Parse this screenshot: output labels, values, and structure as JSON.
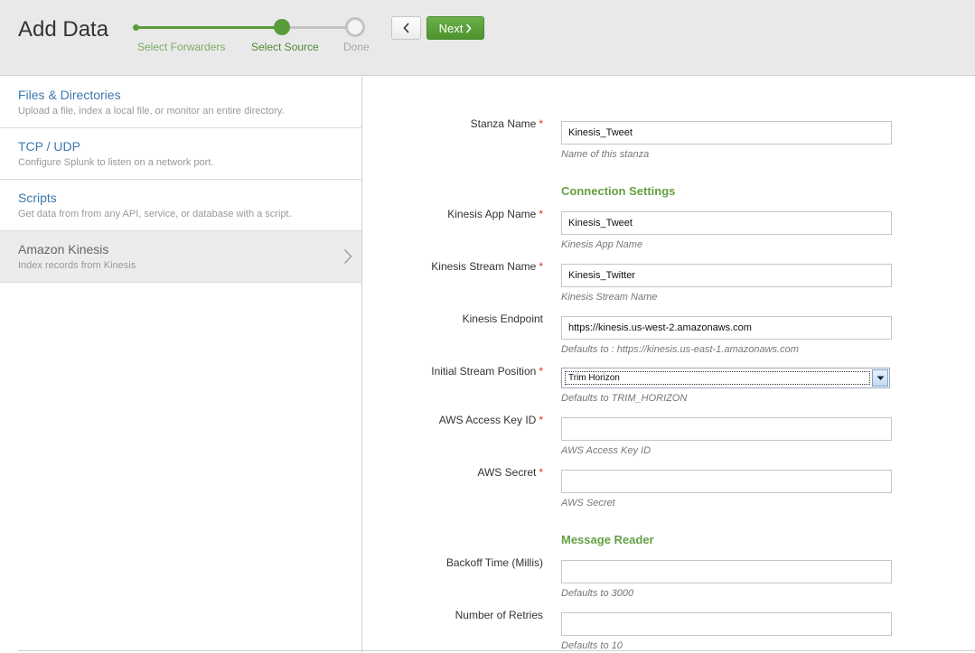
{
  "header": {
    "title": "Add Data",
    "steps": [
      "Select Forwarders",
      "Select Source",
      "Done"
    ],
    "next_label": "Next"
  },
  "sidebar": {
    "items": [
      {
        "title": "Files & Directories",
        "desc": "Upload a file, index a local file, or monitor an entire directory."
      },
      {
        "title": "TCP / UDP",
        "desc": "Configure Splunk to listen on a network port."
      },
      {
        "title": "Scripts",
        "desc": "Get data from from any API, service, or database with a script."
      },
      {
        "title": "Amazon Kinesis",
        "desc": "Index records from Kinesis"
      }
    ]
  },
  "form": {
    "stanza_name": {
      "label": "Stanza Name",
      "value": "Kinesis_Tweet",
      "help": "Name of this stanza"
    },
    "connection_heading": "Connection Settings",
    "app_name": {
      "label": "Kinesis App Name",
      "value": "Kinesis_Tweet",
      "help": "Kinesis App Name"
    },
    "stream_name": {
      "label": "Kinesis Stream Name",
      "value": "Kinesis_Twitter",
      "help": "Kinesis Stream Name"
    },
    "endpoint": {
      "label": "Kinesis Endpoint",
      "value": "https://kinesis.us-west-2.amazonaws.com",
      "help": "Defaults to : https://kinesis.us-east-1.amazonaws.com"
    },
    "stream_position": {
      "label": "Initial Stream Position",
      "value": "Trim Horizon",
      "help": "Defaults to TRIM_HORIZON"
    },
    "access_key": {
      "label": "AWS Access Key ID",
      "value": "",
      "help": "AWS Access Key ID"
    },
    "secret": {
      "label": "AWS Secret",
      "value": "",
      "help": "AWS Secret"
    },
    "reader_heading": "Message Reader",
    "backoff": {
      "label": "Backoff Time (Millis)",
      "value": "",
      "help": "Defaults to 3000"
    },
    "retries": {
      "label": "Number of Retries",
      "value": "",
      "help": "Defaults to 10"
    }
  },
  "colors": {
    "accent_green": "#5a9b3c",
    "link_blue": "#3c78b0",
    "required_red": "#d9302c"
  }
}
